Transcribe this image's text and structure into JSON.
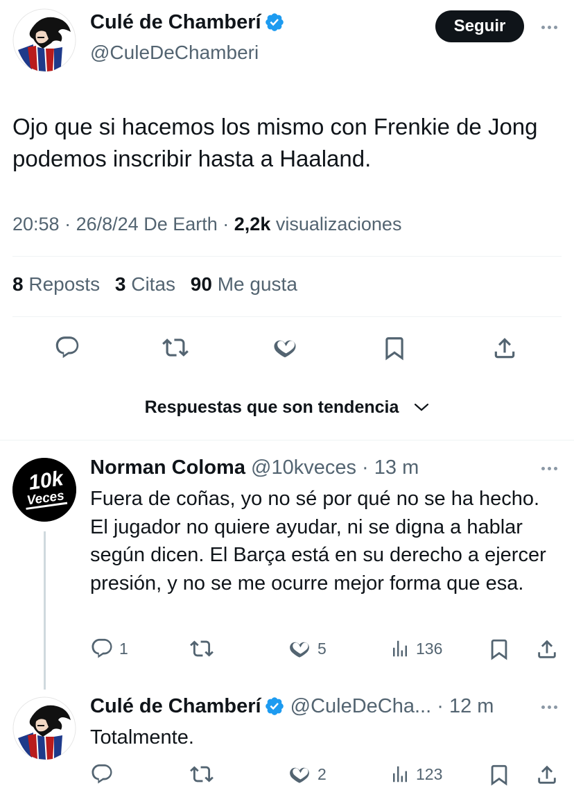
{
  "main_tweet": {
    "author_name": "Culé de Chamberí",
    "handle": "@CuleDeChamberi",
    "follow_label": "Seguir",
    "text": "Ojo que si hacemos los mismo con Frenkie de Jong podemos inscribir hasta a Haaland.",
    "time": "20:58",
    "date": "26/8/24",
    "source": "De Earth",
    "views_count": "2,2k",
    "views_label": "visualizaciones",
    "reposts_count": "8",
    "reposts_label": "Reposts",
    "quotes_count": "3",
    "quotes_label": "Citas",
    "likes_count": "90",
    "likes_label": "Me gusta"
  },
  "trending_label": "Respuestas que son tendencia",
  "replies": [
    {
      "author_name": "Norman Coloma",
      "handle": "@10kveces",
      "time": "13 m",
      "avatar_text_top": "10k",
      "avatar_text_bottom": "Veces",
      "text": "Fuera de coñas, yo no sé por qué no se ha hecho. El jugador no quiere ayudar, ni se digna a hablar según dicen. El Barça está en su derecho a ejercer presión, y no se me ocurre mejor forma que esa.",
      "replies_count": "1",
      "reposts_count": "",
      "likes_count": "5",
      "views_count": "136"
    },
    {
      "author_name": "Culé de Chamberí",
      "handle": "@CuleDeCha...",
      "time": "12 m",
      "text": "Totalmente.",
      "replies_count": "",
      "reposts_count": "",
      "likes_count": "2",
      "views_count": "123"
    }
  ],
  "colors": {
    "text": "#0f1419",
    "muted": "#536471",
    "verified": "#1d9bf0",
    "follow_bg": "#0f1419",
    "divider": "#eff3f4"
  },
  "icons": [
    "reply-icon",
    "repost-icon",
    "like-icon",
    "bookmark-icon",
    "share-icon",
    "views-icon",
    "verified-badge-icon",
    "more-icon",
    "chevron-down-icon"
  ]
}
